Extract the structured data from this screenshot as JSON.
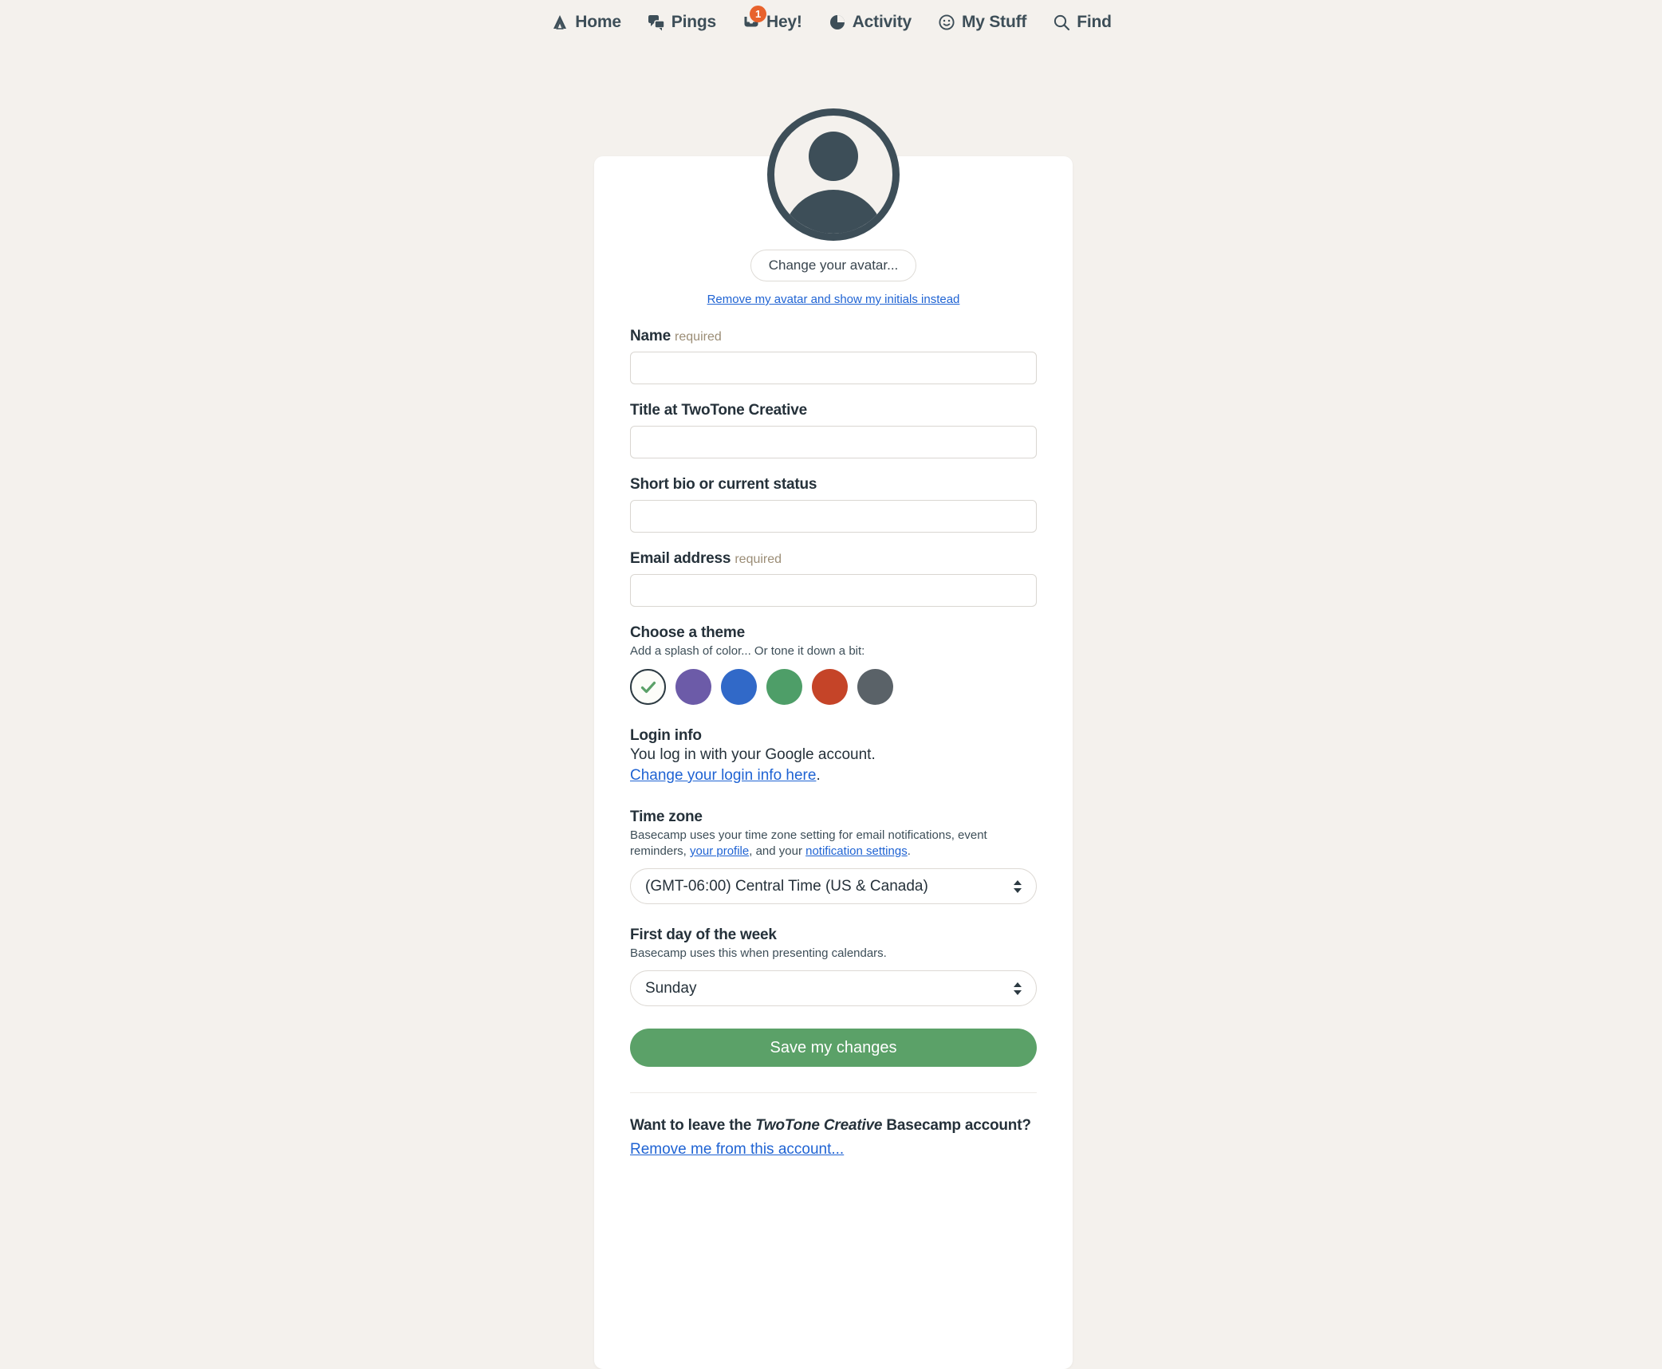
{
  "nav": {
    "items": [
      {
        "label": "Home",
        "icon": "basecamp-tent-icon",
        "badge": null
      },
      {
        "label": "Pings",
        "icon": "speech-bubbles-icon",
        "badge": null
      },
      {
        "label": "Hey!",
        "icon": "inbox-tray-icon",
        "badge": "1"
      },
      {
        "label": "Activity",
        "icon": "activity-pie-icon",
        "badge": null
      },
      {
        "label": "My Stuff",
        "icon": "smiley-face-icon",
        "badge": null
      },
      {
        "label": "Find",
        "icon": "search-icon",
        "badge": null
      }
    ]
  },
  "avatar": {
    "change_button_label": "Change your avatar...",
    "remove_link_label": "Remove my avatar and show my initials instead"
  },
  "form": {
    "name": {
      "label": "Name",
      "required_label": "required",
      "value": "",
      "placeholder": ""
    },
    "title": {
      "label": "Title at TwoTone Creative",
      "value": "",
      "placeholder": ""
    },
    "bio": {
      "label": "Short bio or current status",
      "value": "",
      "placeholder": ""
    },
    "email": {
      "label": "Email address",
      "required_label": "required",
      "value": "",
      "placeholder": ""
    }
  },
  "theme": {
    "title": "Choose a theme",
    "subtitle": "Add a splash of color... Or tone it down a bit:",
    "selected_index": 0,
    "swatches": [
      {
        "name": "default",
        "color": "#fdfdf9",
        "selected": true
      },
      {
        "name": "purple",
        "color": "#6c5ba8",
        "selected": false
      },
      {
        "name": "blue",
        "color": "#3169c8",
        "selected": false
      },
      {
        "name": "green",
        "color": "#4e9e68",
        "selected": false
      },
      {
        "name": "red",
        "color": "#c54428",
        "selected": false
      },
      {
        "name": "gray",
        "color": "#5a6268",
        "selected": false
      }
    ],
    "check_color": "#5ba168"
  },
  "login_info": {
    "title": "Login info",
    "description": "You log in with your Google account.",
    "link_label": "Change your login info here",
    "trailing_period": "."
  },
  "time_zone": {
    "title": "Time zone",
    "desc_part1": "Basecamp uses your time zone setting for email notifications, event reminders, ",
    "link1_label": "your profile",
    "desc_part2": ", and your ",
    "link2_label": "notification settings",
    "desc_part3": ".",
    "selected_value": "(GMT-06:00) Central Time (US & Canada)"
  },
  "first_day": {
    "title": "First day of the week",
    "description": "Basecamp uses this when presenting calendars.",
    "selected_value": "Sunday"
  },
  "save": {
    "label": "Save my changes"
  },
  "leave_account": {
    "heading_part1": "Want to leave the ",
    "heading_account_name": "TwoTone Creative",
    "heading_part2": " Basecamp account?",
    "link_label": "Remove me from this account..."
  },
  "colors": {
    "page_background": "#f4f1ed",
    "card_background": "#ffffff",
    "ink": "#25313a",
    "accent_green": "#5ba168",
    "link_blue": "#1f63d3",
    "badge_orange": "#e8622c",
    "required_tan": "#9b8d76"
  }
}
